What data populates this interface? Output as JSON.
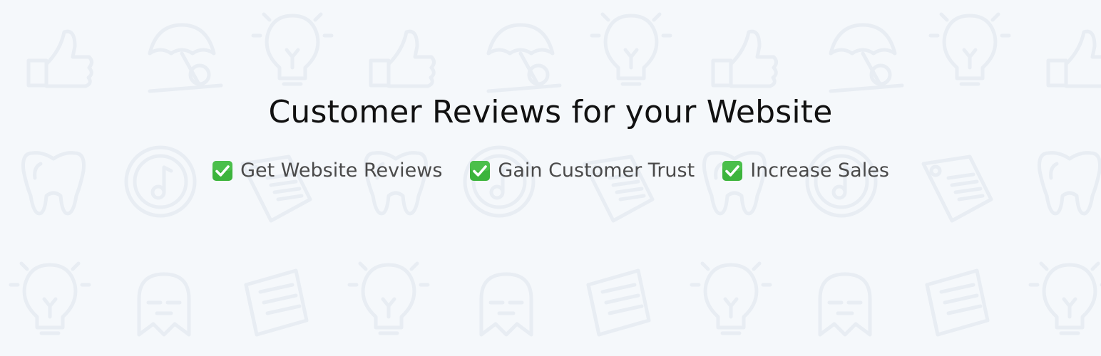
{
  "hero": {
    "title": "Customer Reviews for your Website",
    "features": [
      {
        "label": "Get Website Reviews",
        "icon": "check-mark-button-icon"
      },
      {
        "label": "Gain Customer Trust",
        "icon": "check-mark-button-icon"
      },
      {
        "label": "Increase Sales",
        "icon": "check-mark-button-icon"
      }
    ]
  },
  "colors": {
    "background": "#f5f8fb",
    "pattern": "#e8edf3",
    "title": "#111111",
    "feature_text": "#4a4a4a",
    "check_green": "#3cb43c"
  },
  "background_pattern": {
    "icons": [
      "thumbs-up-icon",
      "beach-umbrella-icon",
      "lightbulb-icon",
      "tooth-icon",
      "music-disc-icon",
      "price-tag-icon",
      "helmet-icon",
      "notepad-icon"
    ]
  }
}
